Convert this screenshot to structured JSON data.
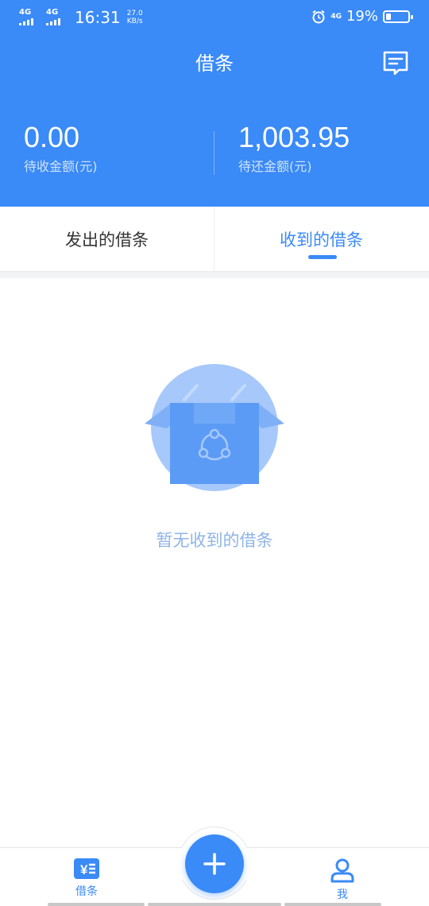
{
  "status_bar": {
    "network1": "4G",
    "network2": "4G",
    "time": "16:31",
    "speed_value": "27.0",
    "speed_unit": "KB/s",
    "network3": "4G",
    "battery_percent": "19%",
    "battery_level": 0.19
  },
  "header": {
    "title": "借条",
    "message_icon": "message-icon"
  },
  "summary": {
    "receivable_value": "0.00",
    "receivable_label": "待收金额(元)",
    "payable_value": "1,003.95",
    "payable_label": "待还金额(元)"
  },
  "tabs": {
    "sent_label": "发出的借条",
    "received_label": "收到的借条",
    "active": "received"
  },
  "empty_state": {
    "icon": "empty-box-icon",
    "text": "暂无收到的借条"
  },
  "bottom_nav": {
    "iou_label": "借条",
    "iou_icon": "yen-list-icon",
    "add_icon": "plus-icon",
    "me_label": "我",
    "me_icon": "user-icon"
  },
  "colors": {
    "primary": "#3a8af7",
    "muted_label": "#cfe2ff",
    "empty_text": "#8fb4e8"
  }
}
